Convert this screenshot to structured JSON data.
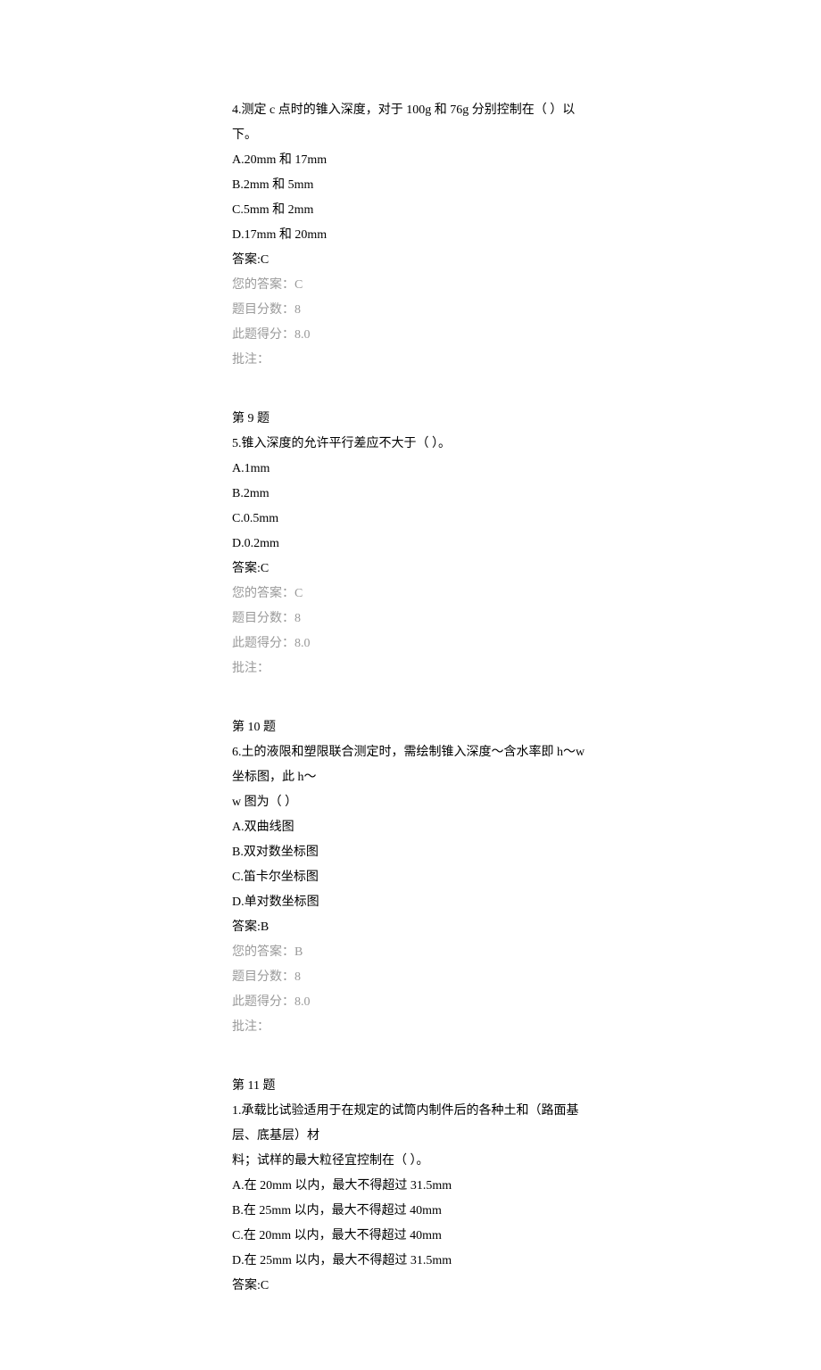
{
  "q8": {
    "stem": "4.测定 c 点时的锥入深度，对于 100g 和 76g 分别控制在（ ）以下。",
    "optA": "A.20mm 和 17mm",
    "optB": "B.2mm 和 5mm",
    "optC": "C.5mm 和 2mm",
    "optD": "D.17mm 和 20mm",
    "answer": "答案:C",
    "your": "您的答案：C",
    "score": "题目分数：8",
    "gotScore": "此题得分：8.0",
    "comment": "批注："
  },
  "q9": {
    "heading": "第 9 题",
    "stem": "5.锥入深度的允许平行差应不大于（ ）。",
    "optA": "A.1mm",
    "optB": "B.2mm",
    "optC": "C.0.5mm",
    "optD": "D.0.2mm",
    "answer": "答案:C",
    "your": "您的答案：C",
    "score": "题目分数：8",
    "gotScore": "此题得分：8.0",
    "comment": "批注："
  },
  "q10": {
    "heading": "第 10 题",
    "stem1": "6.土的液限和塑限联合测定时，需绘制锥入深度～含水率即 h～w 坐标图，此 h～",
    "stem2": "w 图为（ ）",
    "optA": "A.双曲线图",
    "optB": "B.双对数坐标图",
    "optC": "C.笛卡尔坐标图",
    "optD": "D.单对数坐标图",
    "answer": "答案:B",
    "your": "您的答案：B",
    "score": "题目分数：8",
    "gotScore": "此题得分：8.0",
    "comment": "批注："
  },
  "q11": {
    "heading": "第 11 题",
    "stem1": "1.承载比试验适用于在规定的试筒内制件后的各种土和（路面基层、底基层）材",
    "stem2": "料；试样的最大粒径宜控制在（ ）。",
    "optA": "A.在 20mm 以内，最大不得超过 31.5mm",
    "optB": "B.在 25mm 以内，最大不得超过 40mm",
    "optC": "C.在 20mm 以内，最大不得超过 40mm",
    "optD": "D.在 25mm 以内，最大不得超过 31.5mm",
    "answer": "答案:C"
  }
}
